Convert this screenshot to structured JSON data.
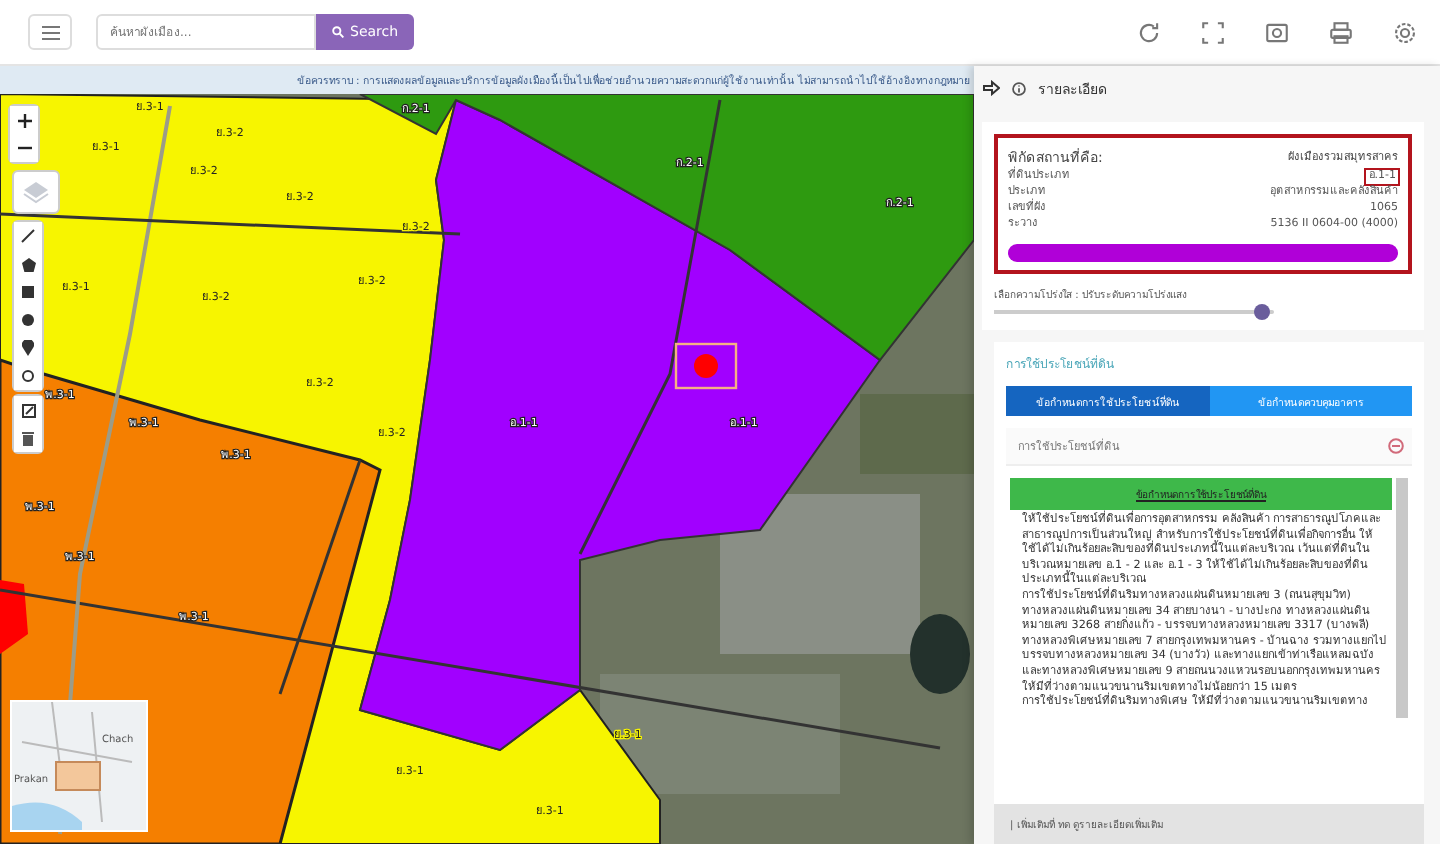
{
  "toolbar": {
    "search": {
      "placeholder": "ค้นหาผังเมือง..."
    },
    "search_button": "Search"
  },
  "notice": "ข้อควรทราบ : การแสดงผลข้อมูลและบริการข้อมูลผังเมืองนี้เป็นไปเพื่อช่วยอำนวยความสะดวกแก่ผู้ใช้งานเท่านั้น ไม่สามารถนำไปใช้อ้างอิงทางกฎหมาย",
  "map": {
    "zones": [
      {
        "label": "ย.3-1"
      },
      {
        "label": "ย.3-2"
      },
      {
        "label": "ย.3-1"
      },
      {
        "label": "ย.3-2"
      },
      {
        "label": "ย.3-2"
      },
      {
        "label": "ย.3-1"
      },
      {
        "label": "ย.3-2"
      },
      {
        "label": "ย.3-2"
      },
      {
        "label": "ย.3-2"
      },
      {
        "label": "ย.3-2"
      },
      {
        "label": "ย.3-2"
      },
      {
        "label": "พ.3-1"
      },
      {
        "label": "พ.3-1"
      },
      {
        "label": "พ.3-1"
      },
      {
        "label": "พ.3-1"
      },
      {
        "label": "พ.3-1"
      },
      {
        "label": "พ.3-1"
      },
      {
        "label": "อ.1-1"
      },
      {
        "label": "อ.1-1"
      },
      {
        "label": "ก.2-1"
      },
      {
        "label": "ก.2-1"
      },
      {
        "label": "ก.2-1"
      },
      {
        "label": "ย.3-1"
      },
      {
        "label": "ย.3-1"
      },
      {
        "label": "ย.3-1"
      }
    ],
    "minimap": {
      "labels": [
        "Chach",
        "Prakan"
      ]
    }
  },
  "panel": {
    "title": "รายละเอียด",
    "location": {
      "heading": "พิกัดสถานที่คือ:",
      "plan": "ผังเมืองรวมสมุทรสาคร",
      "rows": [
        {
          "key": "ที่ดินประเภท",
          "value": "อ.1-1",
          "highlighted": true
        },
        {
          "key": "ประเภท",
          "value": "อุตสาหกรรมและคลังสินค้า",
          "highlighted": false
        },
        {
          "key": "เลขที่ผัง",
          "value": "1065",
          "highlighted": false
        },
        {
          "key": "ระวาง",
          "value": "5136 II 0604-00 (4000)",
          "highlighted": false
        }
      ]
    },
    "opacity": {
      "label": "เลือกความโปร่งใส : ปรับระดับความโปร่งแสง",
      "level": 0.96
    },
    "land_use": {
      "title": "การใช้ประโยชน์ที่ดิน",
      "tabs": [
        {
          "label": "ข้อกำหนดการใช้ประโยชน์ที่ดิน",
          "selected": true
        },
        {
          "label": "ข้อกำหนดควบคุมอาคาร",
          "selected": false
        }
      ],
      "accordion": {
        "title": "การใช้ประโยชน์ที่ดิน",
        "expanded": true,
        "header": "ข้อกำหนดการใช้ประโยชน์ที่ดิน",
        "paragraphs": [
          "ให้ใช้ประโยชน์ที่ดินเพื่อการอุตสาหกรรม คลังสินค้า การสาธารณูปโภคและสาธารณูปการเป็นส่วนใหญ่ สำหรับการใช้ประโยชน์ที่ดินเพื่อกิจการอื่น ให้ใช้ได้ไม่เกินร้อยละสิบของที่ดินประเภทนี้ในแต่ละบริเวณ เว้นแต่ที่ดินในบริเวณหมายเลข อ.1 - 2 และ อ.1 - 3 ให้ใช้ได้ไม่เกินร้อยละสิบของที่ดินประเภทนี้ในแต่ละบริเวณ",
          "การใช้ประโยชน์ที่ดินริมทางหลวงแผ่นดินหมายเลข 3 (ถนนสุขุมวิท) ทางหลวงแผ่นดินหมายเลข 34 สายบางนา - บางปะกง ทางหลวงแผ่นดินหมายเลข 3268 สายกิ่งแก้ว - บรรจบทางหลวงหมายเลข 3317 (บางพลี) ทางหลวงพิเศษหมายเลข 7 สายกรุงเทพมหานคร - บ้านฉาง รวมทางแยกไปบรรจบทางหลวงหมายเลข 34 (บางวัว) และทางแยกเข้าท่าเรือแหลมฉบัง และทางหลวงพิเศษหมายเลข 9 สายถนนวงแหวนรอบนอกกรุงเทพมหานคร ให้มีที่ว่างตามแนวขนานริมเขตทางไม่น้อยกว่า 15 เมตร",
          "การใช้ประโยชน์ที่ดินริมทางพิเศษ ให้มีที่ว่างตามแนวขนานริมเขตทาง"
        ]
      },
      "footer": "| เพิ่มเติมที่ ทด ดูรายละเอียดเพิ่มเติม"
    }
  }
}
